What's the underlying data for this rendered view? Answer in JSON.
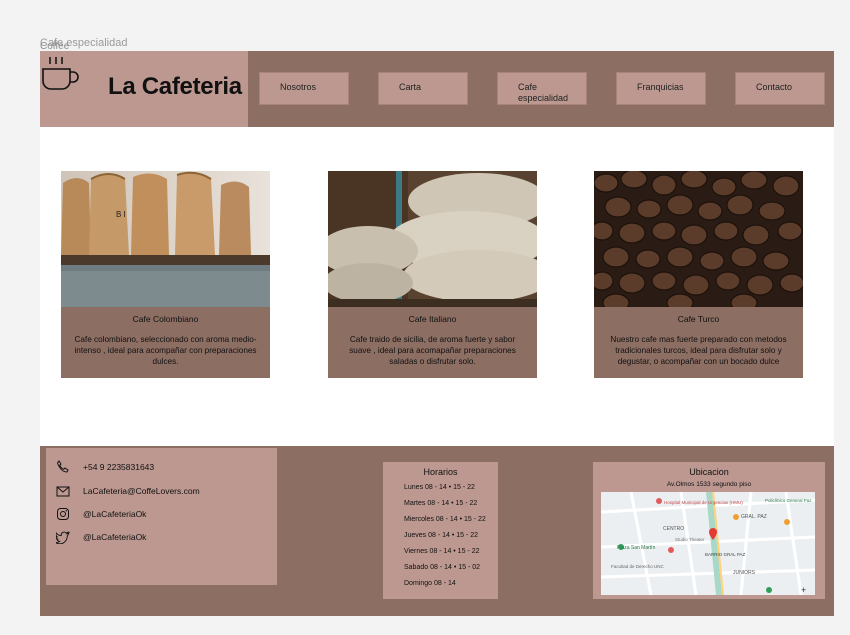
{
  "frame": {
    "label": "Cafe especialidad"
  },
  "logo_overlap": "Coffee",
  "brand": {
    "title": "La Cafeteria",
    "icon": "coffee-cup-icon"
  },
  "nav": [
    {
      "label": "Nosotros"
    },
    {
      "label": "Carta"
    },
    {
      "label": "Cafe especialidad"
    },
    {
      "label": "Franquicias"
    },
    {
      "label": "Contacto"
    }
  ],
  "cards": [
    {
      "title": "Cafe Colombiano",
      "desc": "Cafe colombiano, seleccionado con aroma medio-intenso , ideal para acompañar con preparaciones dulces."
    },
    {
      "title": "Cafe Italiano",
      "desc": "Cafe traido de sicilia, de aroma fuerte y sabor suave , ideal para acomapañar preparaciones saladas o disfrutar solo."
    },
    {
      "title": "Cafe Turco",
      "desc": "Nuestro cafe mas fuerte preparado con metodos tradicionales turcos, ideal para disfrutar solo y degustar, o acompañar con un bocado dulce"
    }
  ],
  "contact": {
    "phone": "+54 9 2235831643",
    "email": "LaCafeteria@CoffeLovers.com",
    "instagram": "@LaCafeteriaOk",
    "twitter": "@LaCafeteriaOk"
  },
  "hours": {
    "title": "Horarios",
    "lines": [
      "Lunes 08 - 14 •  15 - 22",
      "Martes 08 - 14 •  15 - 22",
      "Miercoles 08 - 14 •  15 - 22",
      "Jueves 08 - 14 •  15 - 22",
      "Viernes 08 - 14 •  15 - 22",
      "Sabado 08 - 14 •  15 - 02",
      "Domingo 08 - 14"
    ]
  },
  "location": {
    "title": "Ubicacion",
    "address": "Av.Olmos 1533 segundo piso",
    "map_labels": {
      "hospital": "Hospital Municipal de Urgencias (HMU)",
      "centro": "CENTRO",
      "plaza": "Plaza San Martín",
      "teatro": "Studio Theater",
      "facultad": "Facultad de Derecho UNC",
      "barrio": "BARRIO GRAL PAZ",
      "juniors": "JUNIORS",
      "paz": "GRAL. PAZ",
      "policlinico": "Policlínico General Paz",
      "zoom": "+"
    }
  },
  "colors": {
    "dark": "#8d6e63",
    "light": "#bc9890"
  }
}
